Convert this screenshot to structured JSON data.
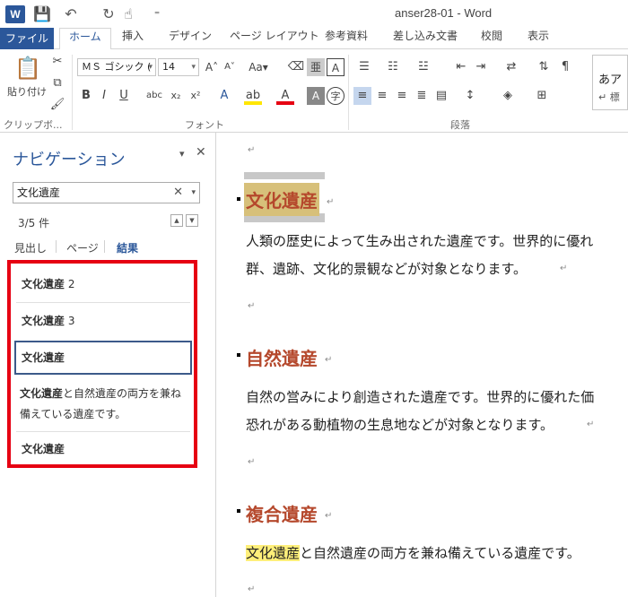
{
  "window": {
    "title": "anser28-01 - Word",
    "app_icon": "W"
  },
  "quick_access": {
    "save": "💾",
    "undo": "↶",
    "redo": "↻",
    "touch": "☝",
    "customize": "⁼"
  },
  "ribbon": {
    "tabs": [
      "ファイル",
      "ホーム",
      "挿入",
      "デザイン",
      "ページ レイアウト",
      "参考資料",
      "差し込み文書",
      "校閲",
      "表示"
    ],
    "paste_label": "貼り付け",
    "clipboard_label": "クリップボ...",
    "font_name": "ＭＳ ゴシック (",
    "font_size": "14",
    "font_group_label": "フォント",
    "paragraph_group_label": "段落",
    "style_preview": "あア",
    "style_preview2": "↵ 標"
  },
  "nav": {
    "title": "ナビゲーション",
    "search_value": "文化遺産",
    "count": "3/5 件",
    "tabs": [
      "見出し",
      "ページ",
      "結果"
    ],
    "results": [
      {
        "bold": "文化遺産",
        "rest": " 2"
      },
      {
        "bold": "文化遺産",
        "rest": " 3"
      },
      {
        "bold": "文化遺産",
        "rest": ""
      }
    ],
    "snippet_bold": "文化遺産",
    "snippet_rest_1": "と自然遺産の両方を兼ね",
    "snippet_rest_2": "備えている遺産です。",
    "last_result": "文化遺産"
  },
  "document": {
    "h1": "文化遺産",
    "p1_line1": "人類の歴史によって生み出された遺産です。世界的に優れ",
    "p1_line2": "群、遺跡、文化的景観などが対象となります。",
    "h2": "自然遺産",
    "p2_line1": "自然の営みにより創造された遺産です。世界的に優れた価",
    "p2_line2": "恐れがある動植物の生息地などが対象となります。",
    "h3": "複合遺産",
    "p3_highlight": "文化遺産",
    "p3_rest": "と自然遺産の両方を兼ね備えている遺産です。",
    "para_mark": "↵"
  },
  "colors": {
    "accent": "#2b579a",
    "heading": "#b5482c",
    "result_border": "#e60012",
    "highlight": "#ffef7a"
  }
}
